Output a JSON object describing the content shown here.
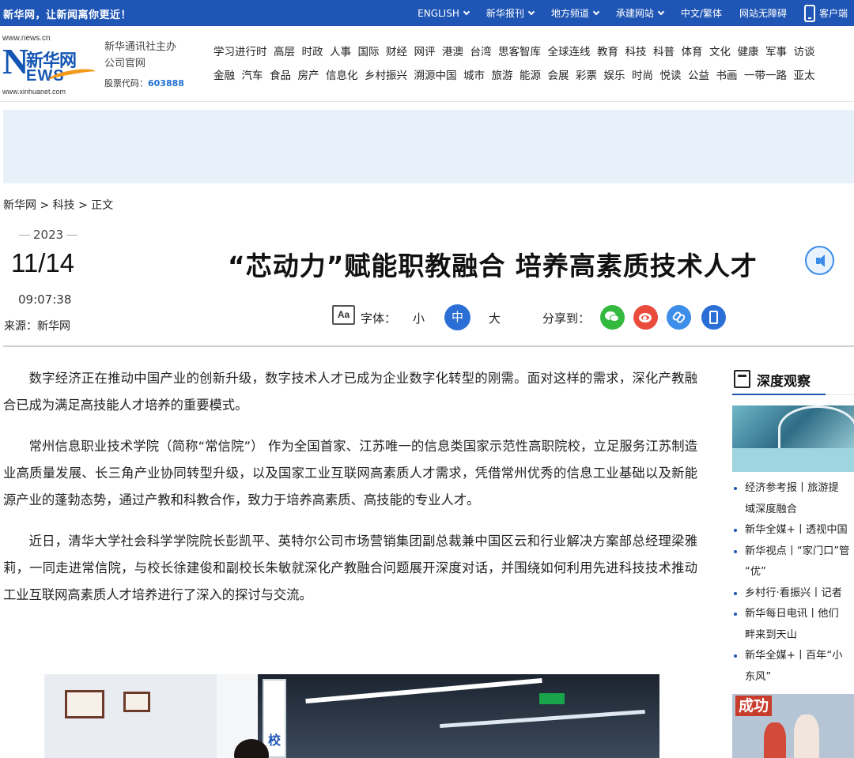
{
  "topbar": {
    "slogan": "新华网，让新闻离你更近！",
    "nav": [
      {
        "label": "ENGLISH",
        "dropdown": true
      },
      {
        "label": "新华报刊",
        "dropdown": true
      },
      {
        "label": "地方频道",
        "dropdown": true
      },
      {
        "label": "承建网站",
        "dropdown": true
      },
      {
        "label": "中文/繁体",
        "dropdown": false
      },
      {
        "label": "网站无障碍",
        "dropdown": false
      }
    ],
    "client_label": "客户端",
    "bg_color": "#1f55b4"
  },
  "logo": {
    "url_top": "www.news.cn",
    "cn": "新华网",
    "en": "EWS",
    "big_letter": "N",
    "url_bottom": "www.xinhuanet.com"
  },
  "org": {
    "line1": "新华通讯社主办",
    "line2": "公司官网",
    "stock_label": "股票代码：",
    "stock_code": "603888"
  },
  "channels": {
    "row1": [
      "学习进行时",
      "高层",
      "时政",
      "人事",
      "国际",
      "财经",
      "网评",
      "港澳",
      "台湾",
      "思客智库",
      "全球连线",
      "教育",
      "科技",
      "科普",
      "体育",
      "文化",
      "健康",
      "军事",
      "访谈"
    ],
    "row2": [
      "金融",
      "汽车",
      "食品",
      "房产",
      "信息化",
      "乡村振兴",
      "溯源中国",
      "城市",
      "旅游",
      "能源",
      "会展",
      "彩票",
      "娱乐",
      "时尚",
      "悦读",
      "公益",
      "书画",
      "一带一路",
      "亚太"
    ]
  },
  "breadcrumb": "新华网 > 科技 > 正文",
  "date": {
    "year": "2023",
    "month_day": "11/14",
    "time": "09:07:38"
  },
  "source": "来源：新华网",
  "title": "“芯动力”赋能职教融合 培养高素质技术人才",
  "tools": {
    "font_icon": "Aa",
    "font_label": "字体：",
    "small": "小",
    "medium": "中",
    "large": "大",
    "share_label": "分享到："
  },
  "article": {
    "paragraphs": [
      "数字经济正在推动中国产业的创新升级，数字技术人才已成为企业数字化转型的刚需。面对这样的需求，深化产教融合已成为满足高技能人才培养的重要模式。",
      "常州信息职业技术学院（简称“常信院”） 作为全国首家、江苏唯一的信息类国家示范性高职院校，立足服务江苏制造业高质量发展、长三角产业协同转型升级，以及国家工业互联网高素质人才需求，凭借常州优秀的信息工业基础以及新能源产业的蓬勃态势，通过产教和科教合作，致力于培养高素质、高技能的专业人才。",
      "近日，清华大学社会科学学院院长彭凯平、英特尔公司市场营销集团副总裁兼中国区云和行业解决方案部总经理梁雅莉，一同走进常信院，与校长徐建俊和副校长朱敏就深化产教融合问题展开深度对话，并围绕如何利用先进科技技术推动工业互联网高素质人才培养进行了深入的探讨与交流。"
    ],
    "photo_sign": "校"
  },
  "sidebar": {
    "title": "深度观察",
    "items": [
      {
        "line1": "经济参考报丨旅游提",
        "line2": "域深度融合"
      },
      {
        "line1": "新华全媒+丨透视中国",
        "line2": ""
      },
      {
        "line1": "新华视点丨“家门口”管",
        "line2": "“优”"
      },
      {
        "line1": "乡村行·看振兴丨记者",
        "line2": ""
      },
      {
        "line1": "新华每日电讯丨他们",
        "line2": "畔来到天山"
      },
      {
        "line1": "新华全媒+丨百年“小",
        "line2": "东风”"
      }
    ],
    "photo2_text": "成功"
  },
  "colors": {
    "brand_blue": "#1f55b4",
    "active_font": "#2b6fd6",
    "wechat": "#33b93d",
    "weibo": "#ea4b3c",
    "link": "#3d8ee8"
  }
}
